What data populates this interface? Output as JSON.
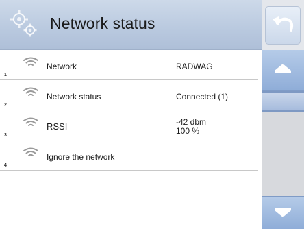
{
  "header": {
    "title": "Network status",
    "icon": "gear-icon"
  },
  "rows": [
    {
      "index": "1",
      "label": "Network",
      "value": "RADWAG"
    },
    {
      "index": "2",
      "label": "Network status",
      "value": "Connected (1)"
    },
    {
      "index": "3",
      "label": "RSSI",
      "value_line1": "-42 dbm",
      "value_line2": "100 %"
    },
    {
      "index": "4",
      "label": "Ignore the network"
    }
  ],
  "right_panel": {
    "undo_icon": "undo-icon",
    "scroll_up_icon": "scroll-up-icon",
    "scroll_down_icon": "scroll-down-icon"
  },
  "colors": {
    "header_bg": "#b9c9df",
    "scroll_button": "#8fadd8"
  }
}
